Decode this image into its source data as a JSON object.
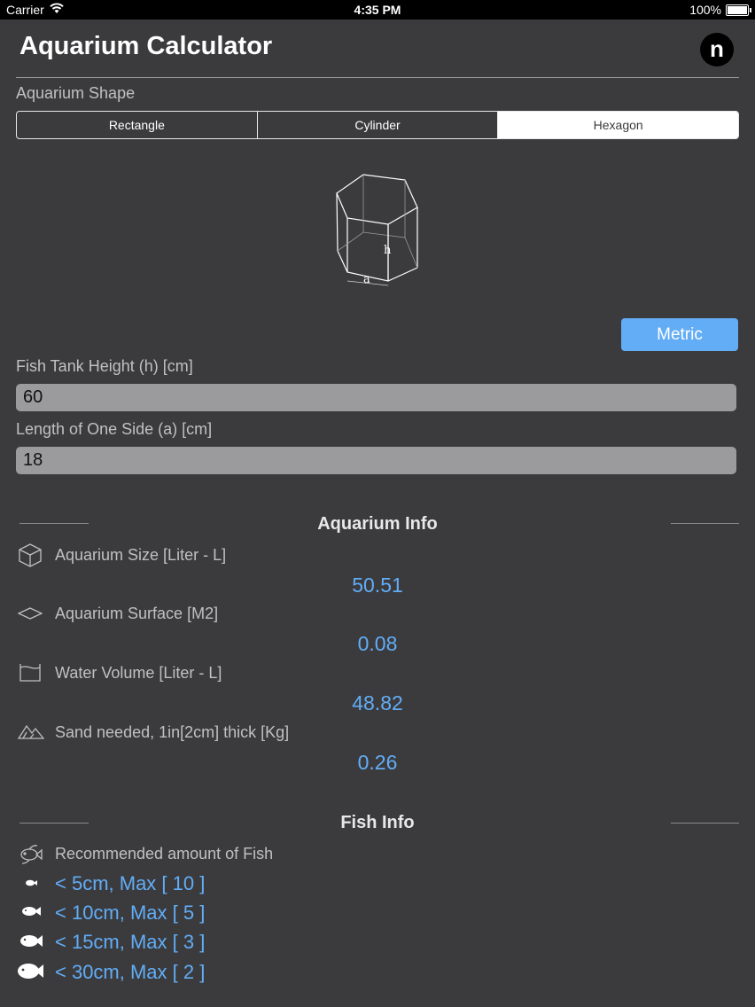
{
  "status": {
    "carrier": "Carrier",
    "time": "4:35 PM",
    "battery": "100%"
  },
  "header": {
    "title": "Aquarium Calculator",
    "logo_letter": "n"
  },
  "shape": {
    "label": "Aquarium Shape",
    "options": [
      "Rectangle",
      "Cylinder",
      "Hexagon"
    ],
    "selected": "Hexagon"
  },
  "diagram": {
    "height_label": "h",
    "side_label": "a"
  },
  "units_button": "Metric",
  "inputs": {
    "height_label": "Fish Tank Height (h) [cm]",
    "height_value": "60",
    "side_label": "Length of One Side (a) [cm]",
    "side_value": "18"
  },
  "aquarium_info": {
    "title": "Aquarium Info",
    "items": [
      {
        "icon": "cube-icon",
        "label": "Aquarium Size [Liter - L]",
        "value": "50.51"
      },
      {
        "icon": "surface-icon",
        "label": "Aquarium Surface [M2]",
        "value": "0.08"
      },
      {
        "icon": "water-volume-icon",
        "label": "Water Volume [Liter - L]",
        "value": "48.82"
      },
      {
        "icon": "sand-icon",
        "label": "Sand needed, 1in[2cm] thick [Kg]",
        "value": "0.26"
      }
    ]
  },
  "fish_info": {
    "title": "Fish Info",
    "recommended_label": "Recommended amount of Fish",
    "rows": [
      "< 5cm, Max [ 10 ]",
      "< 10cm, Max [ 5 ]",
      "< 15cm, Max [ 3 ]",
      "< 30cm, Max [ 2 ]"
    ]
  },
  "colors": {
    "background": "#3b3b3d",
    "accent": "#62adf6",
    "input": "#9b9b9d"
  }
}
